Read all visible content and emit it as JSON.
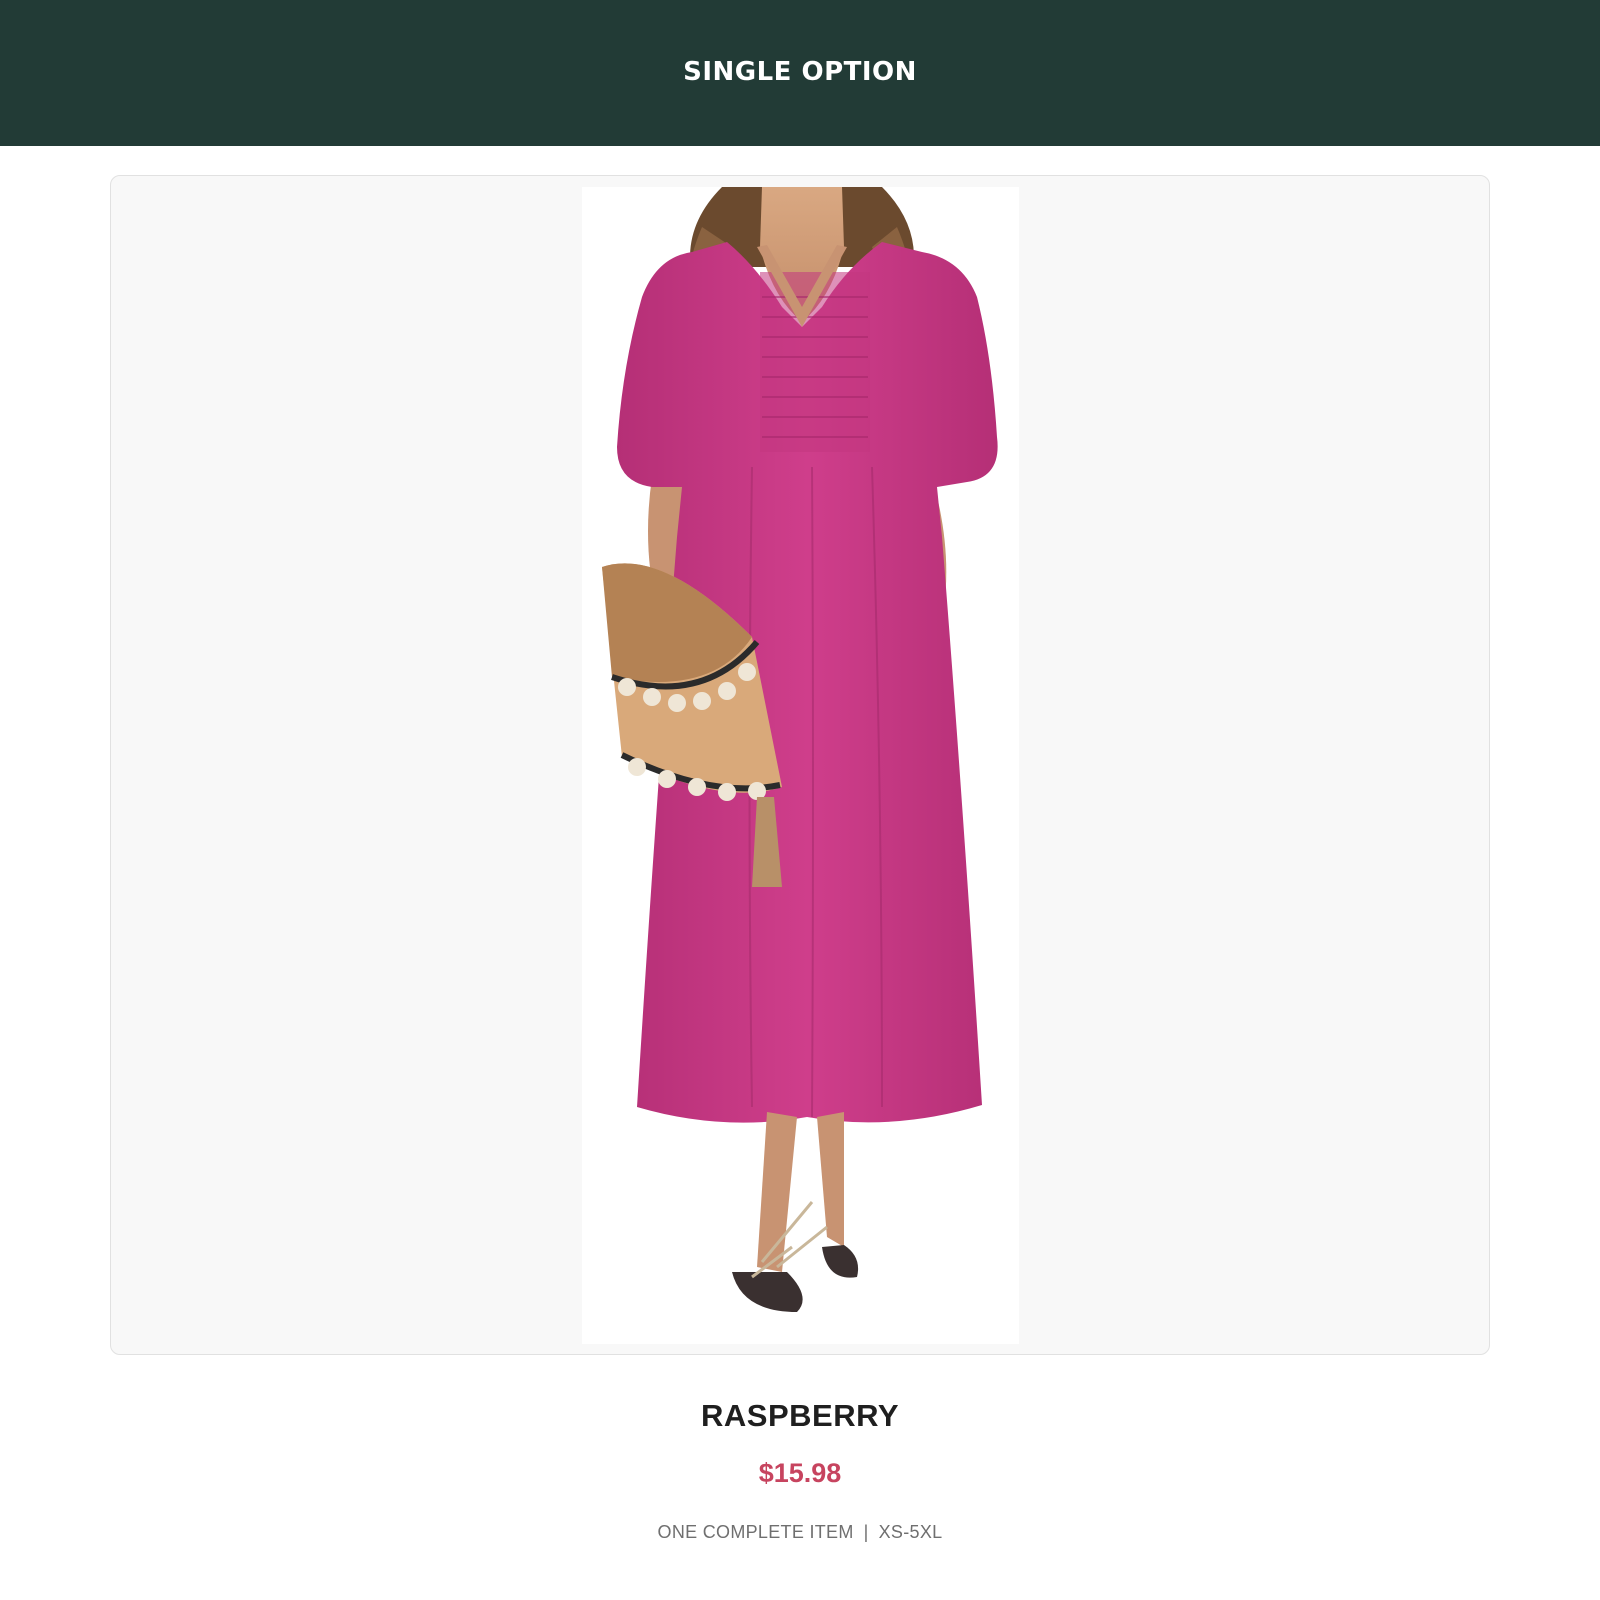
{
  "header": {
    "title": "SINGLE OPTION",
    "background_color": "#223b36"
  },
  "product": {
    "image_alt": "Woman wearing a raspberry pink smocked V-neck midi dress with puff sleeves, holding a woven tasseled clutch",
    "name": "RASPBERRY",
    "price": "$15.98",
    "meta_left": "ONE COMPLETE ITEM",
    "meta_separator": "|",
    "meta_right": "XS-5XL",
    "price_color": "#c7445f",
    "dress_color": "#c93a86"
  }
}
